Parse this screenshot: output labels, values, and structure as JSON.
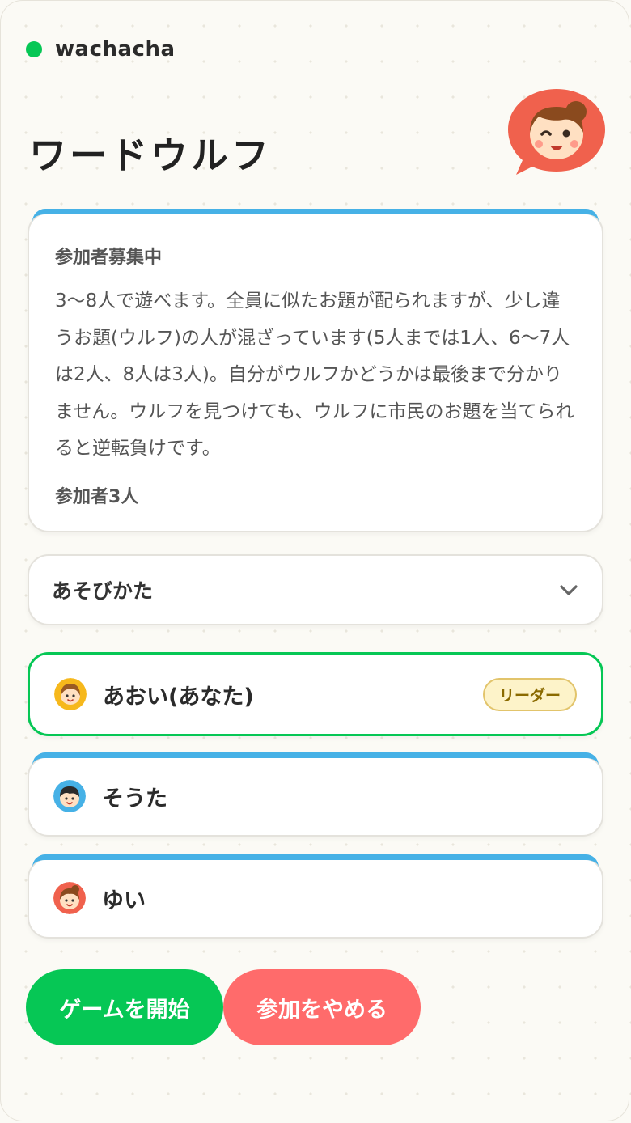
{
  "app": {
    "name": "wachacha",
    "status_color": "#06c755"
  },
  "page": {
    "title": "ワードウルフ"
  },
  "info": {
    "heading": "参加者募集中",
    "description": "3〜8人で遊べます。全員に似たお題が配られますが、少し違うお題(ウルフ)の人が混ざっています(5人までは1人、6〜7人は2人、8人は3人)。自分がウルフかどうかは最後まで分かりません。ウルフを見つけても、ウルフに市民のお題を当てられると逆転負けです。",
    "participant_count": "参加者3人"
  },
  "accordion": {
    "label": "あそびかた",
    "icon": "chevron-down-icon"
  },
  "players": [
    {
      "name": "あおい(あなた)",
      "badge": "リーダー",
      "avatar_color": "#f6b81c"
    },
    {
      "name": "そうた",
      "avatar_color": "#46b1e6"
    },
    {
      "name": "ゆい",
      "avatar_color": "#ff6b6b"
    }
  ],
  "actions": {
    "start": "ゲームを開始",
    "leave": "参加をやめる"
  },
  "colors": {
    "accent_green": "#06c755",
    "accent_red": "#ff6b6b",
    "accent_blue": "#46b1e6"
  }
}
